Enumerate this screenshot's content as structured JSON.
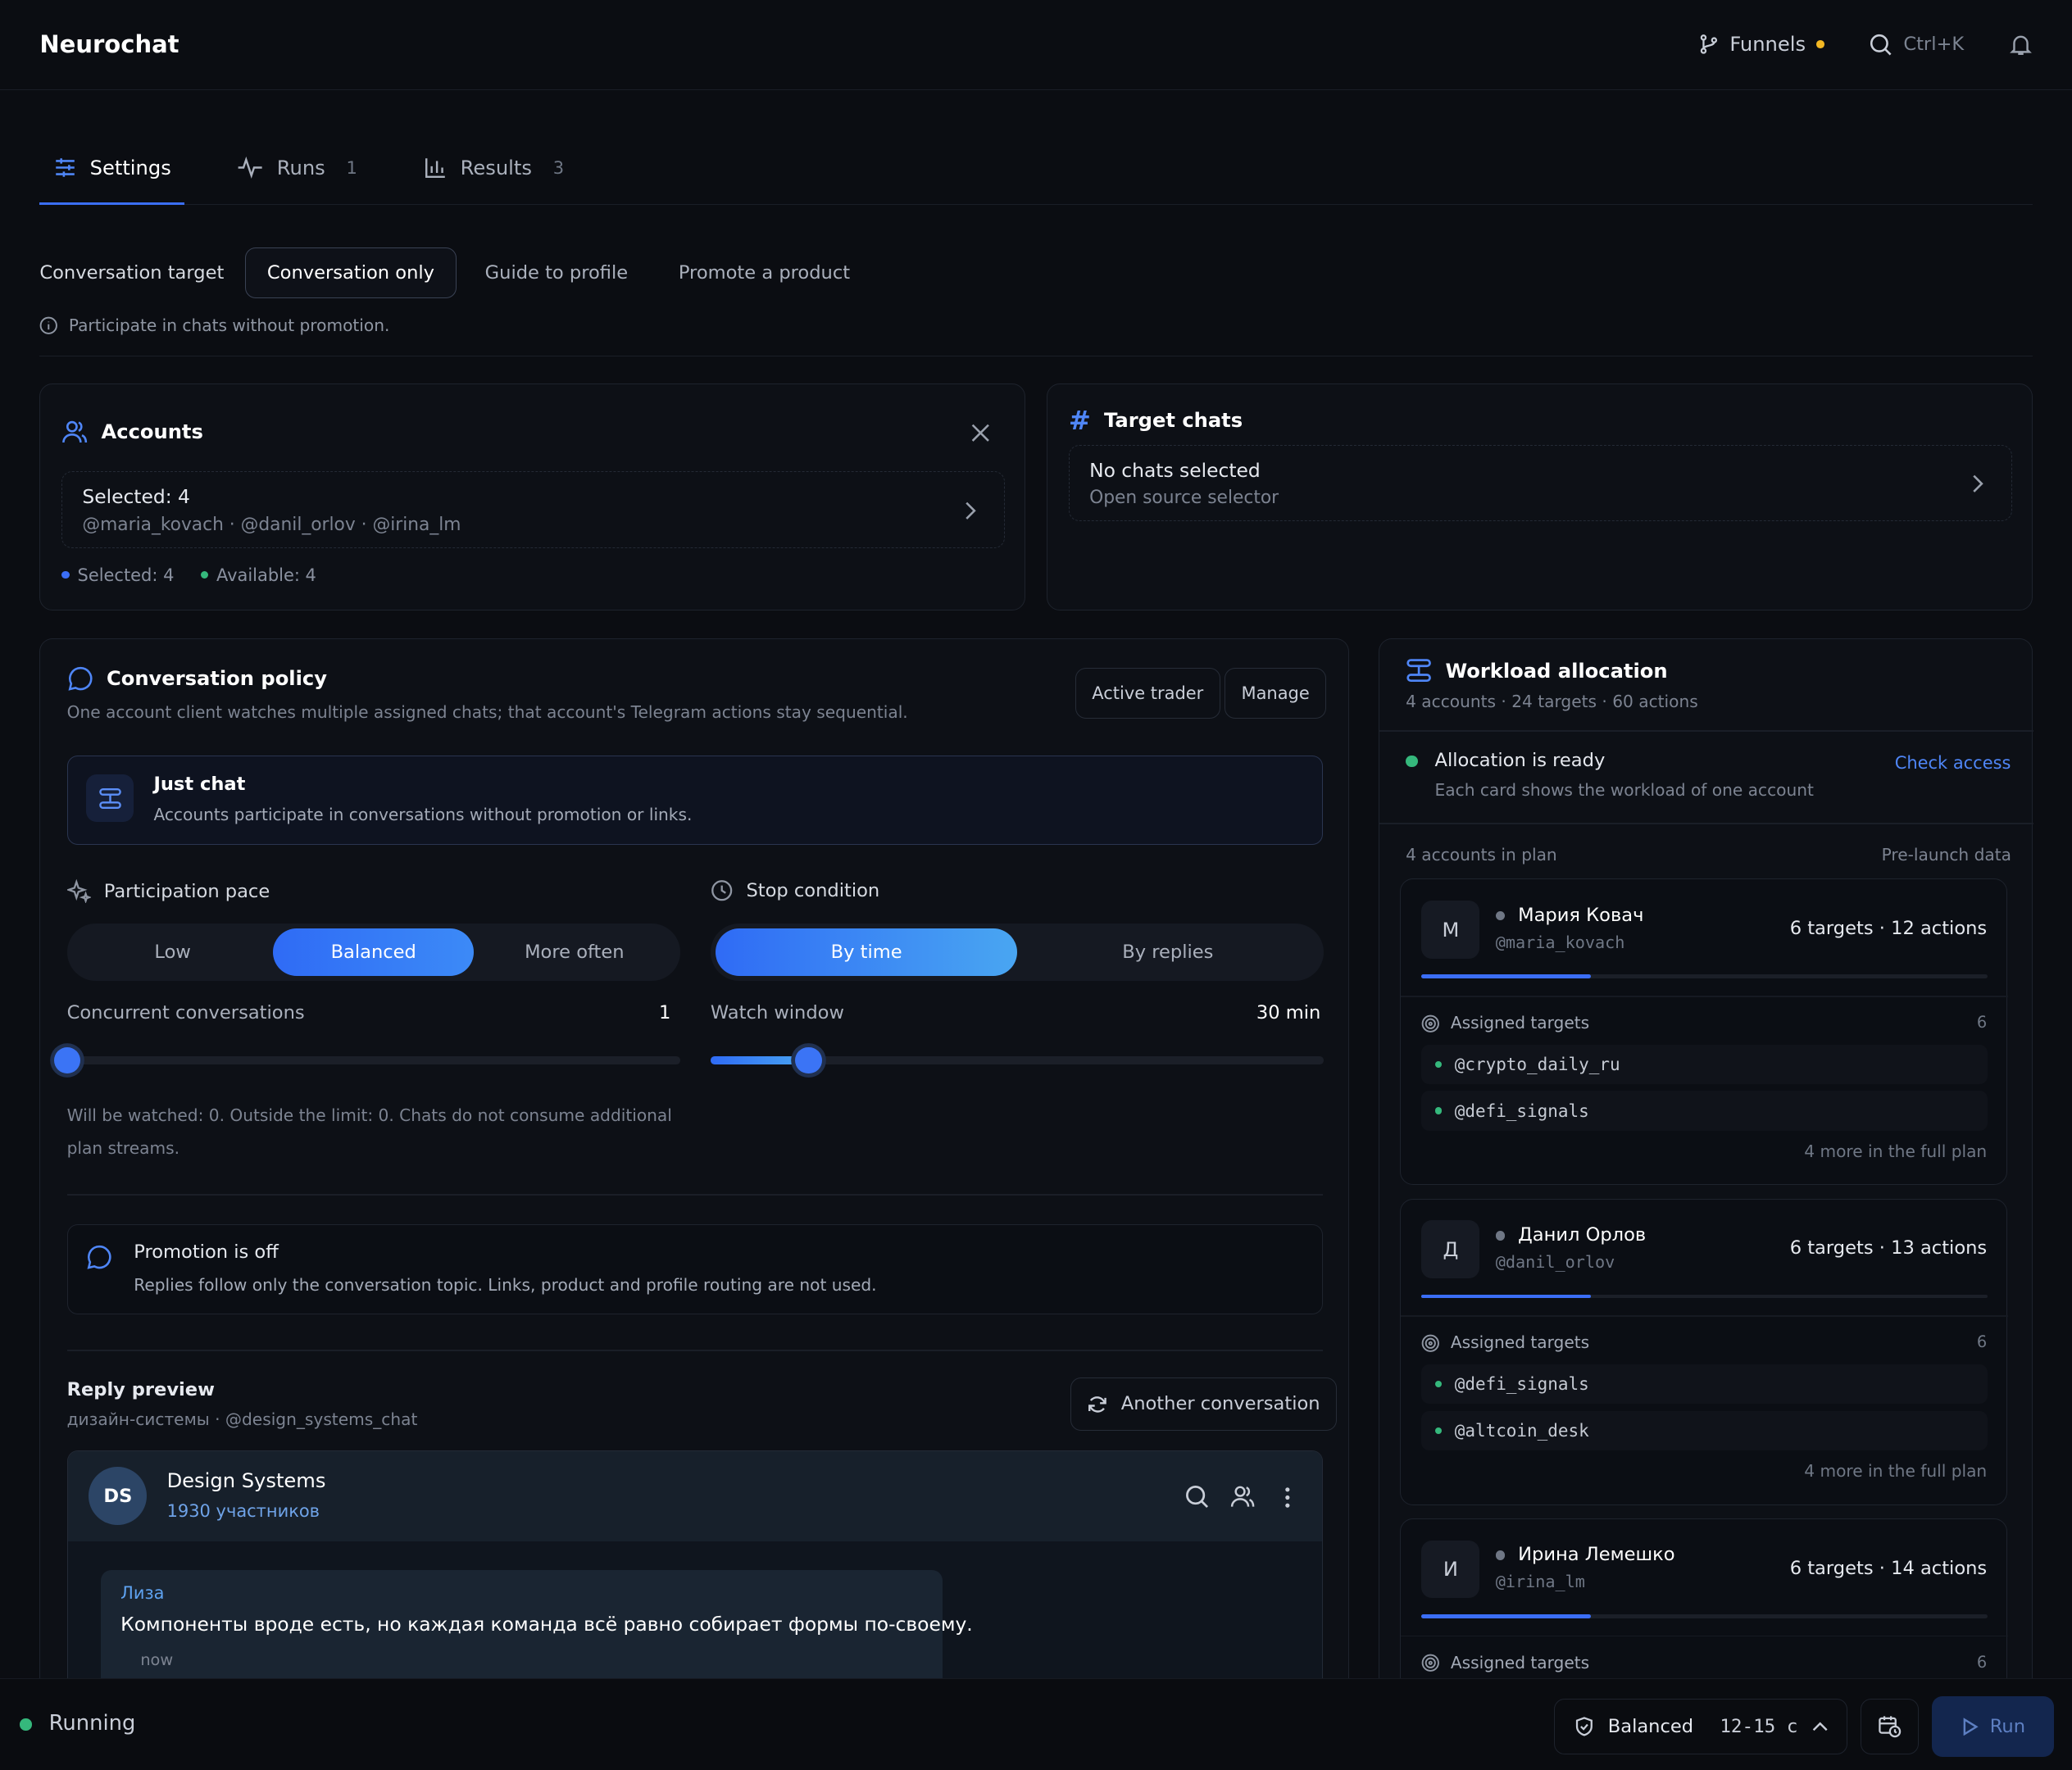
{
  "app": {
    "title": "Neurochat"
  },
  "topbar": {
    "funnels": "Funnels",
    "search_shortcut": "Ctrl+K"
  },
  "tabs": [
    {
      "label": "Settings",
      "count": ""
    },
    {
      "label": "Runs",
      "count": "1"
    },
    {
      "label": "Results",
      "count": "3"
    }
  ],
  "target": {
    "label": "Conversation target",
    "options": [
      "Conversation only",
      "Guide to profile",
      "Promote a product"
    ],
    "hint": "Participate in chats without promotion."
  },
  "accounts": {
    "title": "Accounts",
    "selected_line": "Selected: 4",
    "handles": "@maria_kovach · @danil_orlov · @irina_lm",
    "stat_selected": "Selected: 4",
    "stat_available": "Available: 4"
  },
  "target_chats": {
    "title": "Target chats",
    "empty_title": "No chats selected",
    "empty_sub": "Open source selector"
  },
  "policy": {
    "title": "Conversation policy",
    "desc": "One account client watches multiple assigned chats; that account's Telegram actions stay sequential.",
    "btn_active_trader": "Active trader",
    "btn_manage": "Manage",
    "mode_title": "Just chat",
    "mode_desc": "Accounts participate in conversations without promotion or links.",
    "pace_label": "Participation pace",
    "pace_options": [
      "Low",
      "Balanced",
      "More often"
    ],
    "stop_label": "Stop condition",
    "stop_options": [
      "By time",
      "By replies"
    ],
    "concurrent_label": "Concurrent conversations",
    "concurrent_value": "1",
    "watch_label": "Watch window",
    "watch_value": "30 min",
    "concurrent_level": 0.0,
    "watch_level": 0.16,
    "watch_note": "Will be watched: 0. Outside the limit: 0. Chats do not consume additional plan streams.",
    "promo_title": "Promotion is off",
    "promo_desc": "Replies follow only the conversation topic. Links, product and profile routing are not used."
  },
  "preview": {
    "title": "Reply preview",
    "sub": "дизайн-системы · @design_systems_chat",
    "another_btn": "Another conversation",
    "chat_initials": "DS",
    "chat_name": "Design Systems",
    "chat_members": "1930 участников",
    "msg_author": "Лиза",
    "msg_text": "Компоненты вроде есть, но каждая команда всё равно собирает формы по-своему.",
    "msg_time": "now"
  },
  "workload": {
    "title": "Workload allocation",
    "sub": "4 accounts · 24 targets · 60 actions",
    "ready_title": "Allocation is ready",
    "ready_sub": "Each card shows the workload of one account",
    "check_access": "Check access",
    "list_left": "4 accounts in plan",
    "list_right": "Pre-launch data",
    "assigned_label": "Assigned targets",
    "accounts": [
      {
        "initial": "М",
        "name": "Мария Ковач",
        "handle": "@maria_kovach",
        "summary": "6 targets · 12 actions",
        "count": "6",
        "targets": [
          "@crypto_daily_ru",
          "@defi_signals"
        ],
        "more": "4 more in the full plan",
        "load": 0.3
      },
      {
        "initial": "Д",
        "name": "Данил Орлов",
        "handle": "@danil_orlov",
        "summary": "6 targets · 13 actions",
        "count": "6",
        "targets": [
          "@defi_signals",
          "@altcoin_desk"
        ],
        "more": "4 more in the full plan",
        "load": 0.3
      },
      {
        "initial": "И",
        "name": "Ирина Лемешко",
        "handle": "@irina_lm",
        "summary": "6 targets · 14 actions",
        "count": "6",
        "targets": [],
        "more": "",
        "load": 0.3
      }
    ]
  },
  "bottombar": {
    "status": "Running",
    "mode": "Balanced",
    "range": "12-15 с",
    "run": "Run"
  },
  "colors": {
    "accent": "#3b6ef6",
    "bg": "#0b0d12",
    "success": "#35b87c",
    "warn": "#f3b723"
  }
}
